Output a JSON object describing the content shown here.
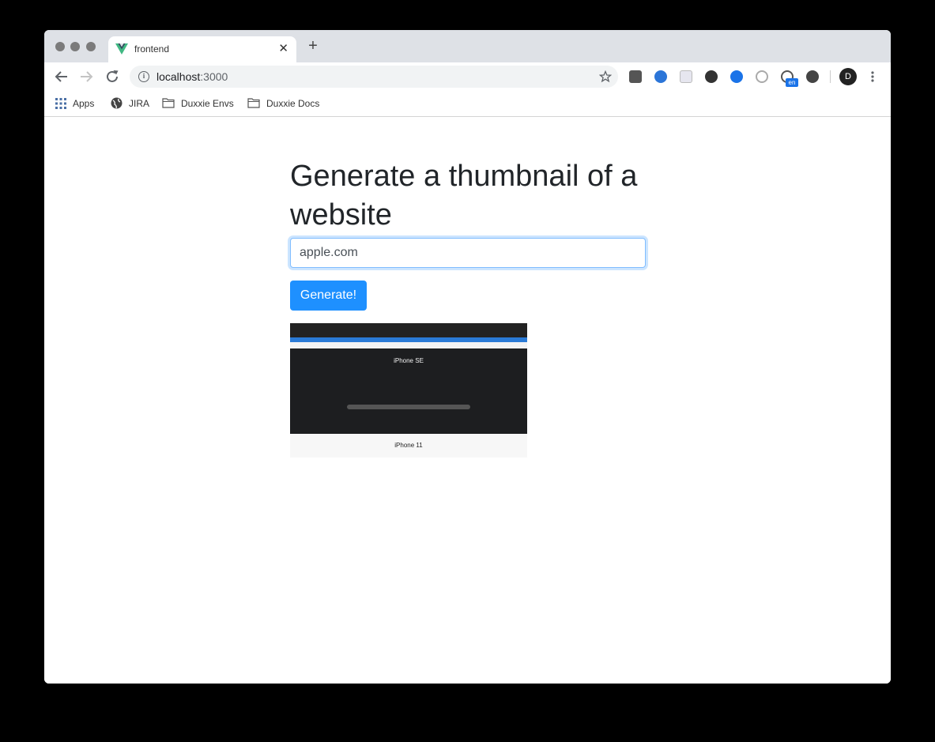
{
  "browser": {
    "tab_title": "frontend",
    "new_tab_glyph": "+",
    "close_glyph": "✕",
    "url_host": "localhost",
    "url_port": ":3000",
    "profile_initial": "D",
    "extension_badge": "en",
    "bookmarks": [
      {
        "label": "Apps",
        "icon": "apps-grid-icon"
      },
      {
        "label": "JIRA",
        "icon": "globe-icon"
      },
      {
        "label": "Duxxie Envs",
        "icon": "folder-icon"
      },
      {
        "label": "Duxxie Docs",
        "icon": "folder-icon"
      }
    ]
  },
  "page": {
    "heading": "Generate a thumbnail of a website",
    "input_value": "apple.com",
    "generate_label": "Generate!",
    "thumbnail": {
      "headline_1": "iPhone SE",
      "headline_2": "iPhone 11"
    }
  },
  "colors": {
    "accent": "#1e90ff",
    "chrome_bg": "#dee1e6",
    "input_focus": "#80bdff"
  }
}
